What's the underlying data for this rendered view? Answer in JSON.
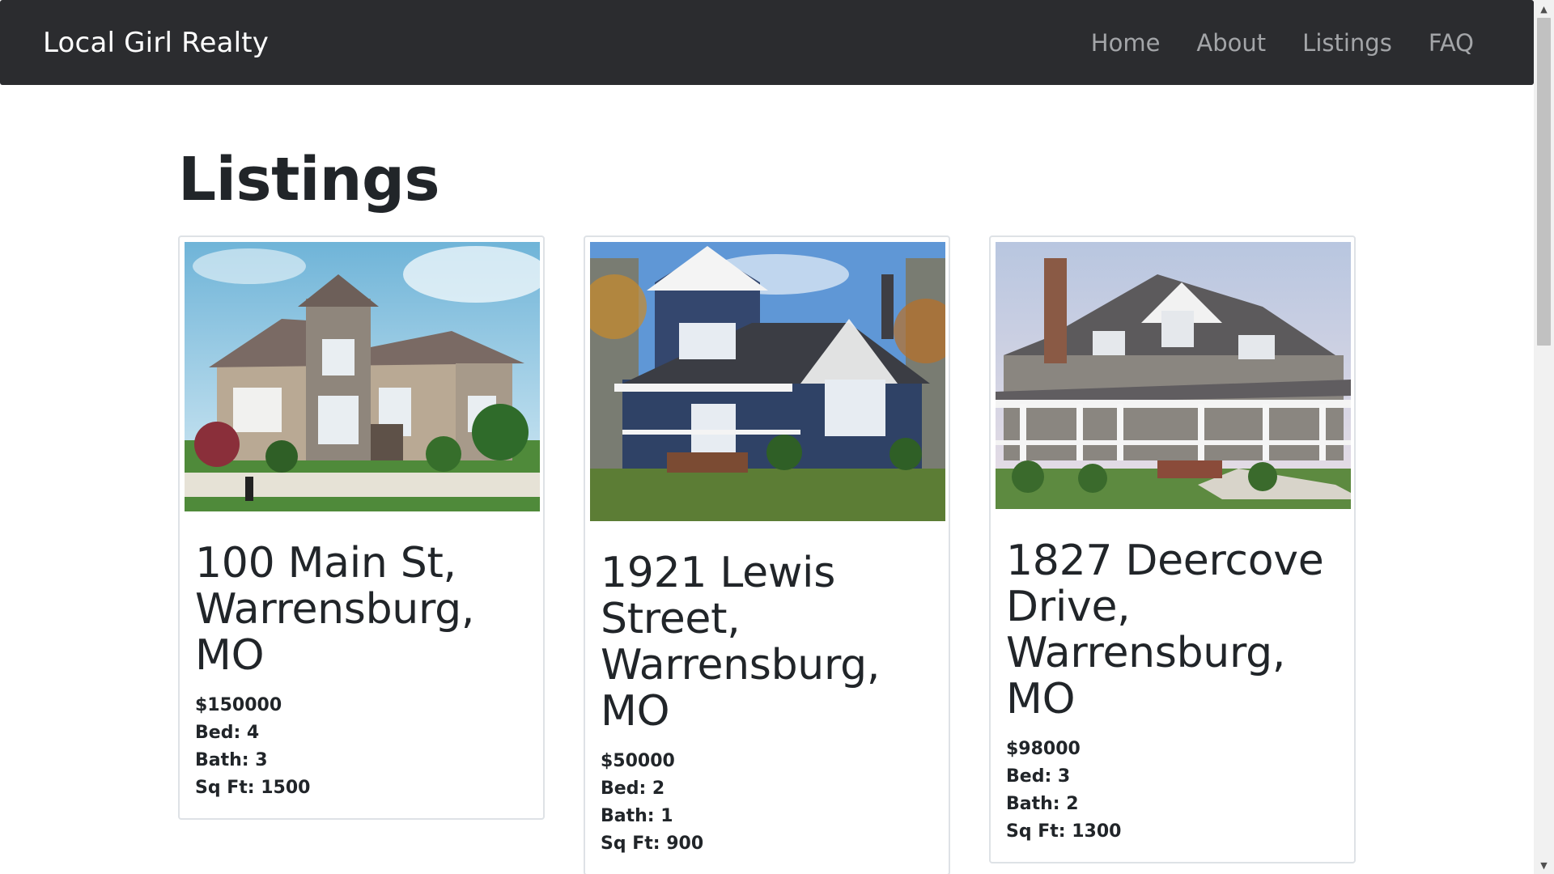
{
  "nav": {
    "brand": "Local Girl Realty",
    "links": [
      {
        "label": "Home"
      },
      {
        "label": "About"
      },
      {
        "label": "Listings"
      },
      {
        "label": "FAQ"
      }
    ]
  },
  "page": {
    "title": "Listings"
  },
  "listings": [
    {
      "address": "100 Main St, Warrensburg, MO",
      "price": "$150000",
      "bed": "Bed: 4",
      "bath": "Bath: 3",
      "sqft": "Sq Ft: 1500",
      "image_icon": "house-photo-stone-two-story"
    },
    {
      "address": "1921 Lewis Street, Warrensburg, MO",
      "price": "$50000",
      "bed": "Bed: 2",
      "bath": "Bath: 1",
      "sqft": "Sq Ft: 900",
      "image_icon": "house-photo-blue-cottage"
    },
    {
      "address": "1827 Deercove Drive, Warrensburg, MO",
      "price": "$98000",
      "bed": "Bed: 3",
      "bath": "Bath: 2",
      "sqft": "Sq Ft: 1300",
      "image_icon": "house-photo-farmhouse-porch"
    }
  ],
  "colors": {
    "navbar_bg": "#2b2c2f",
    "brand_text": "#ffffff",
    "nav_link_text": "#a3a5a8",
    "card_border": "#dee2e6"
  }
}
